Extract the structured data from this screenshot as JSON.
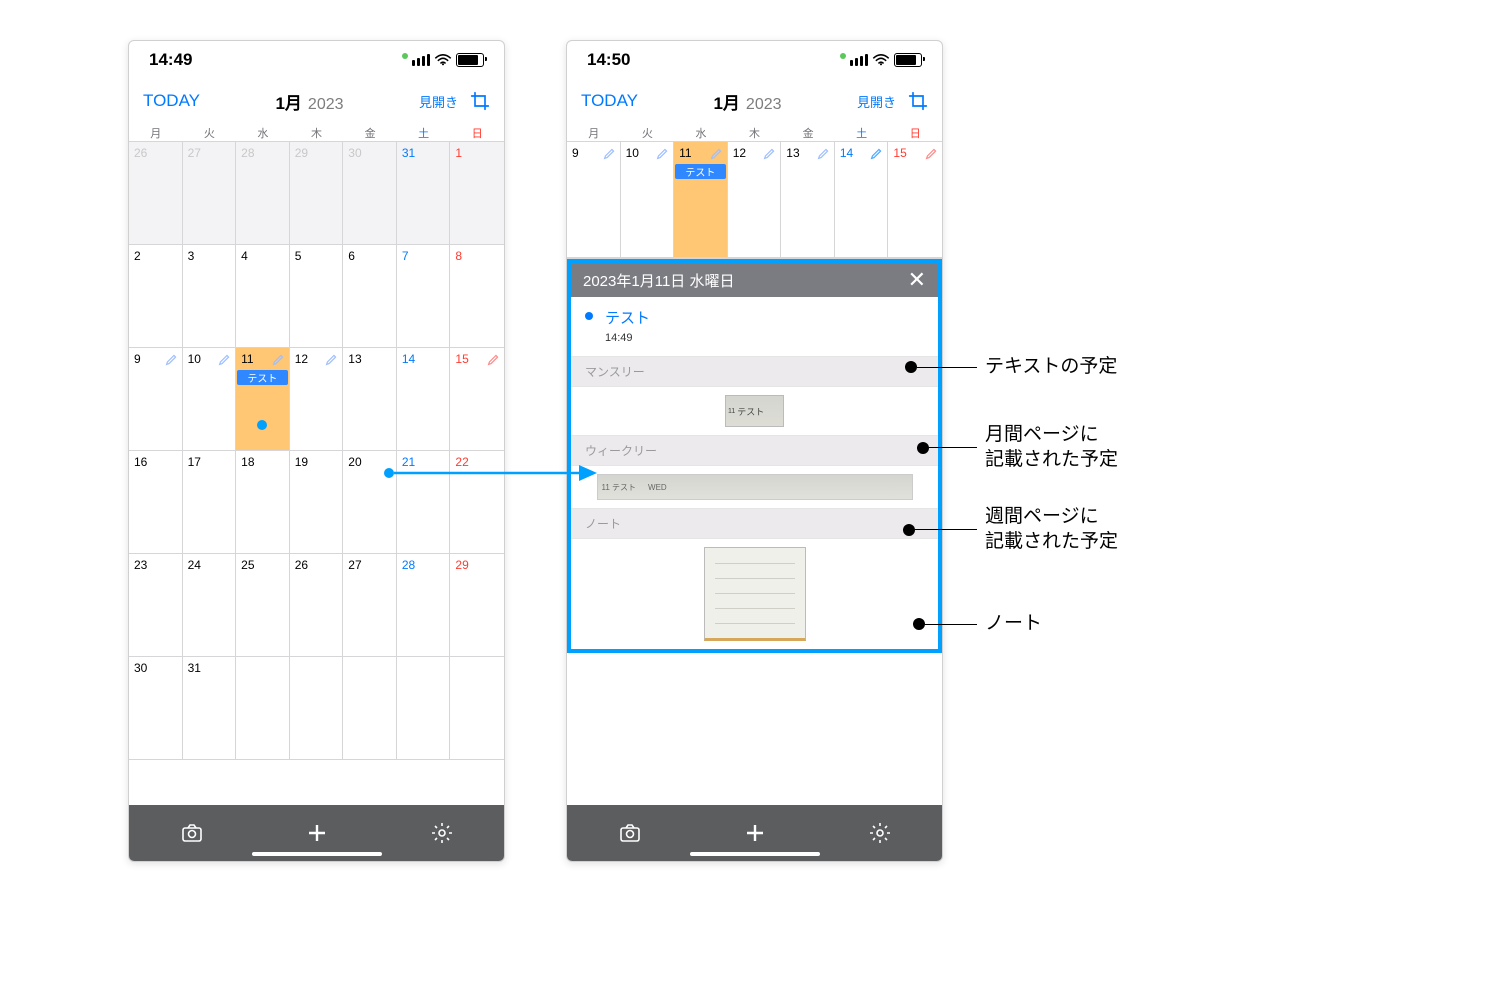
{
  "statusbar": {
    "time_left": "14:49",
    "time_right": "14:50"
  },
  "header": {
    "today_label": "TODAY",
    "month": "1月",
    "year": "2023",
    "mihiraki": "見開き"
  },
  "dow": [
    "月",
    "火",
    "水",
    "木",
    "金",
    "土",
    "日"
  ],
  "month_grid": {
    "rows": [
      [
        {
          "n": "26",
          "prev": true
        },
        {
          "n": "27",
          "prev": true
        },
        {
          "n": "28",
          "prev": true
        },
        {
          "n": "29",
          "prev": true
        },
        {
          "n": "30",
          "prev": true
        },
        {
          "n": "31",
          "prev": true,
          "sat": true
        },
        {
          "n": "1",
          "sun": true
        }
      ],
      [
        {
          "n": "2"
        },
        {
          "n": "3"
        },
        {
          "n": "4"
        },
        {
          "n": "5"
        },
        {
          "n": "6"
        },
        {
          "n": "7",
          "sat": true
        },
        {
          "n": "8",
          "sun": true
        }
      ],
      [
        {
          "n": "9",
          "pen": true
        },
        {
          "n": "10",
          "pen": true
        },
        {
          "n": "11",
          "pen": true,
          "hl": true,
          "event": "テスト"
        },
        {
          "n": "12",
          "pen": true
        },
        {
          "n": "13"
        },
        {
          "n": "14",
          "sat": true
        },
        {
          "n": "15",
          "sun": true,
          "pen": true
        }
      ],
      [
        {
          "n": "16"
        },
        {
          "n": "17"
        },
        {
          "n": "18"
        },
        {
          "n": "19"
        },
        {
          "n": "20"
        },
        {
          "n": "21",
          "sat": true
        },
        {
          "n": "22",
          "sun": true
        }
      ],
      [
        {
          "n": "23"
        },
        {
          "n": "24"
        },
        {
          "n": "25"
        },
        {
          "n": "26"
        },
        {
          "n": "27"
        },
        {
          "n": "28",
          "sat": true
        },
        {
          "n": "29",
          "sun": true
        }
      ],
      [
        {
          "n": "30"
        },
        {
          "n": "31"
        },
        {
          "n": "",
          "blank": true
        },
        {
          "n": "",
          "blank": true
        },
        {
          "n": "",
          "blank": true
        },
        {
          "n": "",
          "blank": true
        },
        {
          "n": "",
          "blank": true
        }
      ]
    ]
  },
  "week_strip": [
    {
      "n": "9",
      "pen": true
    },
    {
      "n": "10",
      "pen": true
    },
    {
      "n": "11",
      "pen": true,
      "hl": true,
      "event": "テスト"
    },
    {
      "n": "12",
      "pen": true
    },
    {
      "n": "13",
      "pen": true
    },
    {
      "n": "14",
      "sat": true,
      "pen": true
    },
    {
      "n": "15",
      "sun": true,
      "pen": true
    }
  ],
  "detail": {
    "title": "2023年1月11日 水曜日",
    "event_title": "テスト",
    "event_time": "14:49",
    "sections": {
      "monthly": "マンスリー",
      "weekly": "ウィークリー",
      "note": "ノート"
    },
    "monthly_label": "テスト",
    "weekly_label": "11 テスト"
  },
  "callouts": {
    "text_event": "テキストの予定",
    "monthly1": "月間ページに",
    "monthly2": "記載された予定",
    "weekly1": "週間ページに",
    "weekly2": "記載された予定",
    "note": "ノート"
  }
}
